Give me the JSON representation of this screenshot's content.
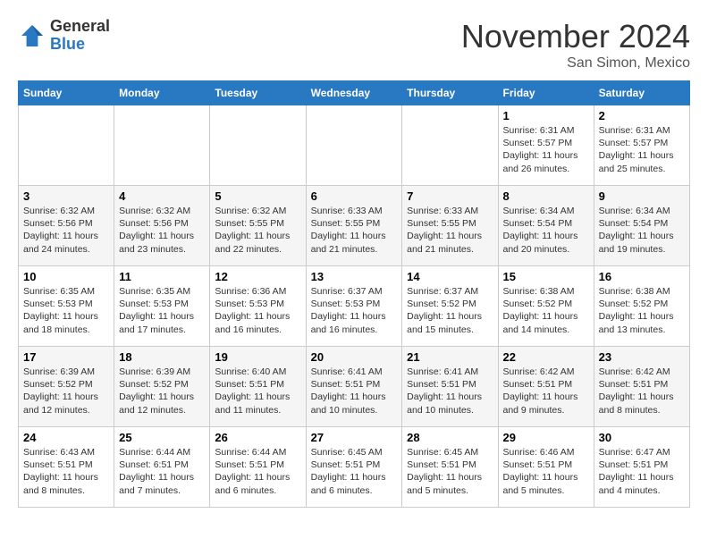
{
  "header": {
    "logo_general": "General",
    "logo_blue": "Blue",
    "month_title": "November 2024",
    "location": "San Simon, Mexico"
  },
  "weekdays": [
    "Sunday",
    "Monday",
    "Tuesday",
    "Wednesday",
    "Thursday",
    "Friday",
    "Saturday"
  ],
  "weeks": [
    [
      {
        "day": "",
        "sunrise": "",
        "sunset": "",
        "daylight": ""
      },
      {
        "day": "",
        "sunrise": "",
        "sunset": "",
        "daylight": ""
      },
      {
        "day": "",
        "sunrise": "",
        "sunset": "",
        "daylight": ""
      },
      {
        "day": "",
        "sunrise": "",
        "sunset": "",
        "daylight": ""
      },
      {
        "day": "",
        "sunrise": "",
        "sunset": "",
        "daylight": ""
      },
      {
        "day": "1",
        "sunrise": "Sunrise: 6:31 AM",
        "sunset": "Sunset: 5:57 PM",
        "daylight": "Daylight: 11 hours and 26 minutes."
      },
      {
        "day": "2",
        "sunrise": "Sunrise: 6:31 AM",
        "sunset": "Sunset: 5:57 PM",
        "daylight": "Daylight: 11 hours and 25 minutes."
      }
    ],
    [
      {
        "day": "3",
        "sunrise": "Sunrise: 6:32 AM",
        "sunset": "Sunset: 5:56 PM",
        "daylight": "Daylight: 11 hours and 24 minutes."
      },
      {
        "day": "4",
        "sunrise": "Sunrise: 6:32 AM",
        "sunset": "Sunset: 5:56 PM",
        "daylight": "Daylight: 11 hours and 23 minutes."
      },
      {
        "day": "5",
        "sunrise": "Sunrise: 6:32 AM",
        "sunset": "Sunset: 5:55 PM",
        "daylight": "Daylight: 11 hours and 22 minutes."
      },
      {
        "day": "6",
        "sunrise": "Sunrise: 6:33 AM",
        "sunset": "Sunset: 5:55 PM",
        "daylight": "Daylight: 11 hours and 21 minutes."
      },
      {
        "day": "7",
        "sunrise": "Sunrise: 6:33 AM",
        "sunset": "Sunset: 5:55 PM",
        "daylight": "Daylight: 11 hours and 21 minutes."
      },
      {
        "day": "8",
        "sunrise": "Sunrise: 6:34 AM",
        "sunset": "Sunset: 5:54 PM",
        "daylight": "Daylight: 11 hours and 20 minutes."
      },
      {
        "day": "9",
        "sunrise": "Sunrise: 6:34 AM",
        "sunset": "Sunset: 5:54 PM",
        "daylight": "Daylight: 11 hours and 19 minutes."
      }
    ],
    [
      {
        "day": "10",
        "sunrise": "Sunrise: 6:35 AM",
        "sunset": "Sunset: 5:53 PM",
        "daylight": "Daylight: 11 hours and 18 minutes."
      },
      {
        "day": "11",
        "sunrise": "Sunrise: 6:35 AM",
        "sunset": "Sunset: 5:53 PM",
        "daylight": "Daylight: 11 hours and 17 minutes."
      },
      {
        "day": "12",
        "sunrise": "Sunrise: 6:36 AM",
        "sunset": "Sunset: 5:53 PM",
        "daylight": "Daylight: 11 hours and 16 minutes."
      },
      {
        "day": "13",
        "sunrise": "Sunrise: 6:37 AM",
        "sunset": "Sunset: 5:53 PM",
        "daylight": "Daylight: 11 hours and 16 minutes."
      },
      {
        "day": "14",
        "sunrise": "Sunrise: 6:37 AM",
        "sunset": "Sunset: 5:52 PM",
        "daylight": "Daylight: 11 hours and 15 minutes."
      },
      {
        "day": "15",
        "sunrise": "Sunrise: 6:38 AM",
        "sunset": "Sunset: 5:52 PM",
        "daylight": "Daylight: 11 hours and 14 minutes."
      },
      {
        "day": "16",
        "sunrise": "Sunrise: 6:38 AM",
        "sunset": "Sunset: 5:52 PM",
        "daylight": "Daylight: 11 hours and 13 minutes."
      }
    ],
    [
      {
        "day": "17",
        "sunrise": "Sunrise: 6:39 AM",
        "sunset": "Sunset: 5:52 PM",
        "daylight": "Daylight: 11 hours and 12 minutes."
      },
      {
        "day": "18",
        "sunrise": "Sunrise: 6:39 AM",
        "sunset": "Sunset: 5:52 PM",
        "daylight": "Daylight: 11 hours and 12 minutes."
      },
      {
        "day": "19",
        "sunrise": "Sunrise: 6:40 AM",
        "sunset": "Sunset: 5:51 PM",
        "daylight": "Daylight: 11 hours and 11 minutes."
      },
      {
        "day": "20",
        "sunrise": "Sunrise: 6:41 AM",
        "sunset": "Sunset: 5:51 PM",
        "daylight": "Daylight: 11 hours and 10 minutes."
      },
      {
        "day": "21",
        "sunrise": "Sunrise: 6:41 AM",
        "sunset": "Sunset: 5:51 PM",
        "daylight": "Daylight: 11 hours and 10 minutes."
      },
      {
        "day": "22",
        "sunrise": "Sunrise: 6:42 AM",
        "sunset": "Sunset: 5:51 PM",
        "daylight": "Daylight: 11 hours and 9 minutes."
      },
      {
        "day": "23",
        "sunrise": "Sunrise: 6:42 AM",
        "sunset": "Sunset: 5:51 PM",
        "daylight": "Daylight: 11 hours and 8 minutes."
      }
    ],
    [
      {
        "day": "24",
        "sunrise": "Sunrise: 6:43 AM",
        "sunset": "Sunset: 5:51 PM",
        "daylight": "Daylight: 11 hours and 8 minutes."
      },
      {
        "day": "25",
        "sunrise": "Sunrise: 6:44 AM",
        "sunset": "Sunset: 6:51 PM",
        "daylight": "Daylight: 11 hours and 7 minutes."
      },
      {
        "day": "26",
        "sunrise": "Sunrise: 6:44 AM",
        "sunset": "Sunset: 5:51 PM",
        "daylight": "Daylight: 11 hours and 6 minutes."
      },
      {
        "day": "27",
        "sunrise": "Sunrise: 6:45 AM",
        "sunset": "Sunset: 5:51 PM",
        "daylight": "Daylight: 11 hours and 6 minutes."
      },
      {
        "day": "28",
        "sunrise": "Sunrise: 6:45 AM",
        "sunset": "Sunset: 5:51 PM",
        "daylight": "Daylight: 11 hours and 5 minutes."
      },
      {
        "day": "29",
        "sunrise": "Sunrise: 6:46 AM",
        "sunset": "Sunset: 5:51 PM",
        "daylight": "Daylight: 11 hours and 5 minutes."
      },
      {
        "day": "30",
        "sunrise": "Sunrise: 6:47 AM",
        "sunset": "Sunset: 5:51 PM",
        "daylight": "Daylight: 11 hours and 4 minutes."
      }
    ]
  ]
}
